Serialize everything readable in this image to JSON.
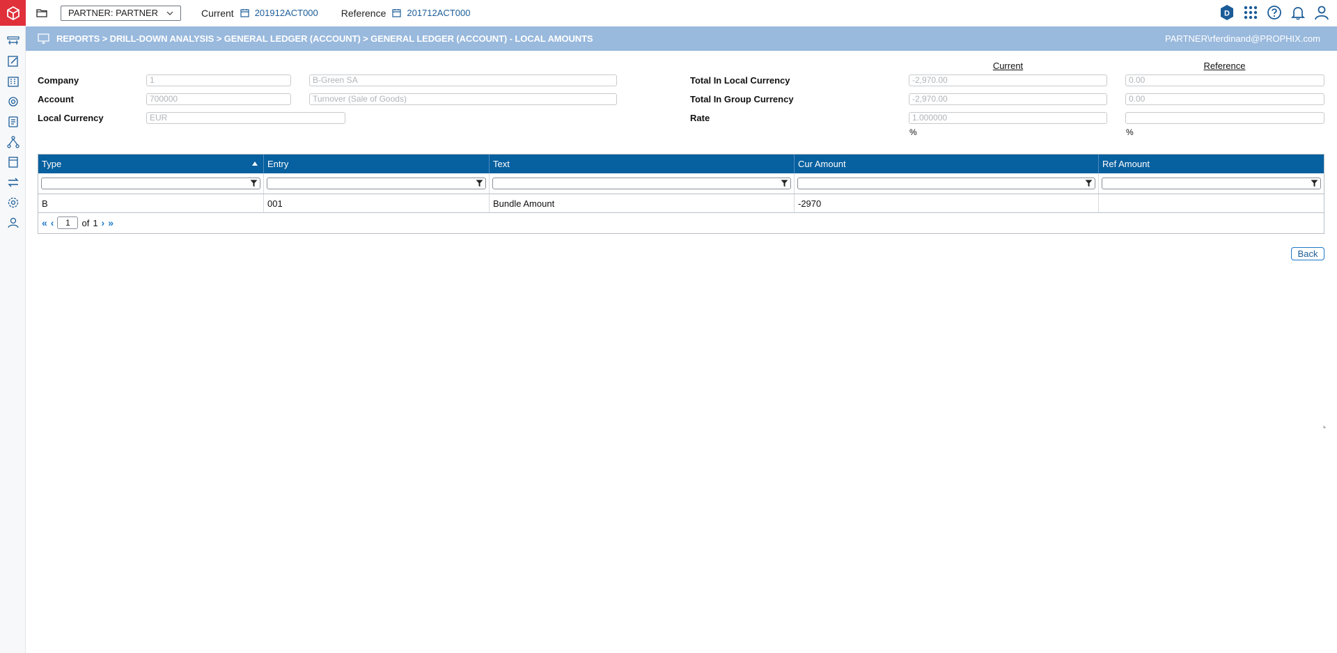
{
  "topbar": {
    "partner_select": "PARTNER: PARTNER",
    "current_label": "Current",
    "current_value": "201912ACT000",
    "reference_label": "Reference",
    "reference_value": "201712ACT000",
    "badge_letter": "D"
  },
  "band": {
    "breadcrumb": "REPORTS > DRILL-DOWN ANALYSIS > GENERAL LEDGER (ACCOUNT) > GENERAL LEDGER (ACCOUNT) - LOCAL AMOUNTS",
    "user": "PARTNER\\rferdinand@PROPHIX.com"
  },
  "form": {
    "company_label": "Company",
    "company_code": "1",
    "company_name": "B-Green SA",
    "account_label": "Account",
    "account_code": "700000",
    "account_name": "Turnover (Sale of Goods)",
    "local_currency_label": "Local Currency",
    "local_currency": "EUR",
    "current_head": "Current",
    "reference_head": "Reference",
    "total_local_label": "Total In Local Currency",
    "total_local_current": "-2,970.00",
    "total_local_reference": "0.00",
    "total_group_label": "Total In Group Currency",
    "total_group_current": "-2,970.00",
    "total_group_reference": "0.00",
    "rate_label": "Rate",
    "rate_current": "1.000000",
    "rate_reference": "",
    "pct_current": "%",
    "pct_reference": "%"
  },
  "grid": {
    "columns": [
      "Type",
      "Entry",
      "Text",
      "Cur Amount",
      "Ref Amount"
    ],
    "rows": [
      [
        "B",
        "001",
        "Bundle Amount",
        "-2970",
        ""
      ]
    ],
    "pager": {
      "page": "1",
      "of_label": "of",
      "total": "1"
    }
  },
  "actions": {
    "back_label": "Back"
  },
  "colors": {
    "brand_red": "#e0303a",
    "header_blue": "#07609f",
    "band_blue": "#99b9dd",
    "link_blue": "#1b5c98"
  }
}
